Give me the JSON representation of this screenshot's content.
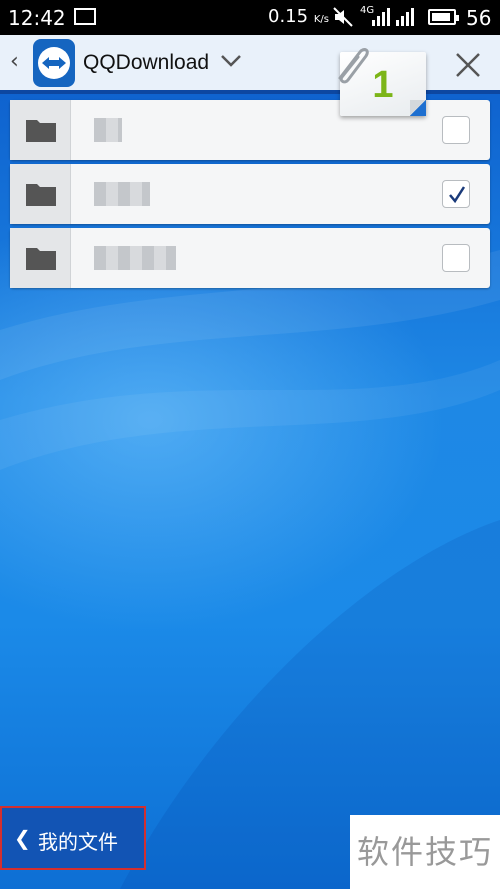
{
  "status_bar": {
    "time": "12:42",
    "net_speed": "0.15",
    "net_speed_unit": "K/s",
    "network_type": "4G",
    "battery_level": "56"
  },
  "header": {
    "title": "QQDownload",
    "attachment_count": "1"
  },
  "folders": [
    {
      "name": "▒▒",
      "checked": false
    },
    {
      "name": "▒▒▒▒",
      "checked": true
    },
    {
      "name": "▒▒▒▒▒▒",
      "checked": false
    }
  ],
  "bottom": {
    "my_files_label": "我的文件"
  },
  "watermark": "软件技巧",
  "colors": {
    "header_bg": "#e9f1fa",
    "header_border": "#0d47a1",
    "accent_green": "#7cb518",
    "background_blue": "#1a7fe0",
    "highlight_red": "#d32f2f"
  }
}
